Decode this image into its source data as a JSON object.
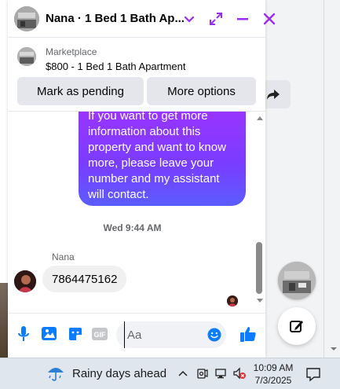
{
  "header": {
    "title": "Nana · 1 Bed 1 Bath Ap...",
    "icons": [
      "chevron-down-icon",
      "expand-icon",
      "minimize-icon",
      "close-icon"
    ]
  },
  "marketplace": {
    "label": "Marketplace",
    "listing": "$800 - 1 Bed 1 Bath Apartment",
    "pending_button": "Mark as pending",
    "options_button": "More options"
  },
  "messages": {
    "outgoing_lines": [
      "If you want to get more",
      "information about this",
      "property and want to know",
      "more, please leave your",
      "number and my assistant",
      "will contact."
    ],
    "date_separator": "Wed 9:44 AM",
    "sender_name": "Nana",
    "incoming_text": "7864475162"
  },
  "composer": {
    "placeholder": "Aa",
    "icons": [
      "microphone-icon",
      "photo-icon",
      "sticker-icon",
      "gif-icon",
      "emoji-icon",
      "thumbs-up-icon"
    ],
    "gif_text": "GIF"
  },
  "taskbar": {
    "weather": "Rainy days ahead",
    "time": "10:09 AM",
    "date": "7/3/2025"
  },
  "colors": {
    "accent": "#9b2cf5",
    "bubble_top": "#a033ff",
    "bubble_bottom": "#5b5cff",
    "like_blue": "#0a7cff"
  }
}
